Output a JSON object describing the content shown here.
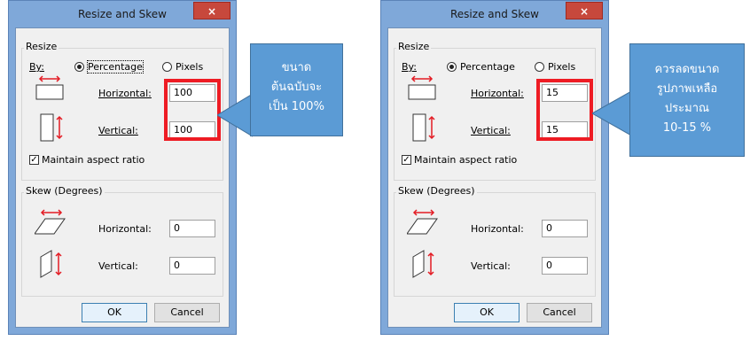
{
  "dialogs": [
    {
      "title": "Resize and Skew",
      "close_symbol": "×",
      "resize": {
        "group_label": "Resize",
        "by_label": "By:",
        "percentage_label": "Percentage",
        "pixels_label": "Pixels",
        "horizontal_label": "Horizontal:",
        "horizontal_value": "100",
        "vertical_label": "Vertical:",
        "vertical_value": "100",
        "maintain_label": "Maintain aspect ratio"
      },
      "skew": {
        "group_label": "Skew (Degrees)",
        "horizontal_label": "Horizontal:",
        "horizontal_value": "0",
        "vertical_label": "Vertical:",
        "vertical_value": "0"
      },
      "ok_label": "OK",
      "cancel_label": "Cancel"
    },
    {
      "title": "Resize and Skew",
      "close_symbol": "×",
      "resize": {
        "group_label": "Resize",
        "by_label": "By:",
        "percentage_label": "Percentage",
        "pixels_label": "Pixels",
        "horizontal_label": "Horizontal:",
        "horizontal_value": "15",
        "vertical_label": "Vertical:",
        "vertical_value": "15",
        "maintain_label": "Maintain aspect ratio"
      },
      "skew": {
        "group_label": "Skew (Degrees)",
        "horizontal_label": "Horizontal:",
        "horizontal_value": "0",
        "vertical_label": "Vertical:",
        "vertical_value": "0"
      },
      "ok_label": "OK",
      "cancel_label": "Cancel"
    }
  ],
  "callouts": [
    {
      "lines": [
        "ขนาด",
        "ต้นฉบับจะ",
        "เป็น 100%"
      ]
    },
    {
      "lines": [
        "ควรลดขนาด",
        "รูปภาพเหลือ",
        "ประมาณ",
        "10-15 %"
      ]
    }
  ],
  "colors": {
    "highlight": "#ee1c24",
    "callout_fill": "#5b9bd5",
    "title_bar": "#7fa8d9",
    "close_button": "#c7483c"
  }
}
